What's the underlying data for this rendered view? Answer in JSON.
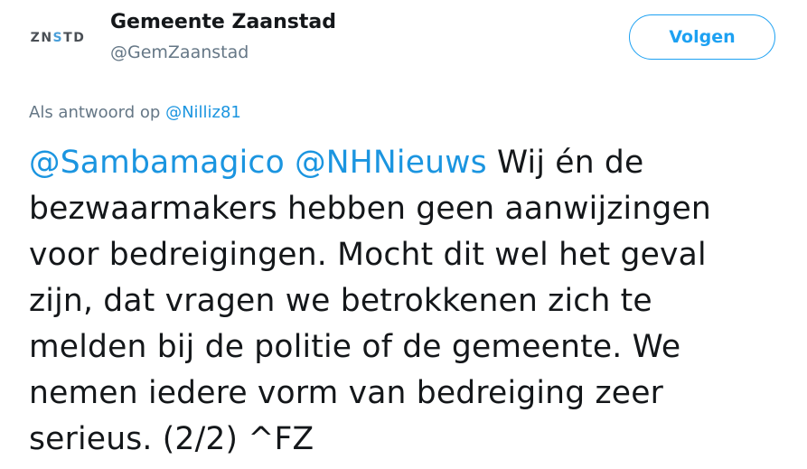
{
  "account": {
    "avatar_text_pre": "ZN",
    "avatar_text_accent": "S",
    "avatar_text_post": "TD",
    "display_name": "Gemeente Zaanstad",
    "handle": "@GemZaanstad"
  },
  "follow_button": {
    "label": "Volgen",
    "color": "#1da1f2"
  },
  "reply": {
    "prefix": "Als antwoord op",
    "to": "@Nilliz81"
  },
  "tweet": {
    "mention_1": "@Sambamagico",
    "mention_2": "@NHNieuws",
    "line_1_text": "Wij én de",
    "line_2": "bezwaarmakers hebben geen aanwijzingen",
    "line_3": "voor bedreigingen. Mocht dit wel het geval",
    "line_4": "zijn, dat vragen we betrokkenen zich te",
    "line_5": "melden bij de politie of de gemeente. We",
    "line_6": "nemen iedere vorm van bedreiging zeer",
    "line_7": "serieus. (2/2) ^FZ"
  },
  "colors": {
    "link": "#1b95e0",
    "secondary_text": "#657786",
    "primary_text": "#14171a"
  }
}
